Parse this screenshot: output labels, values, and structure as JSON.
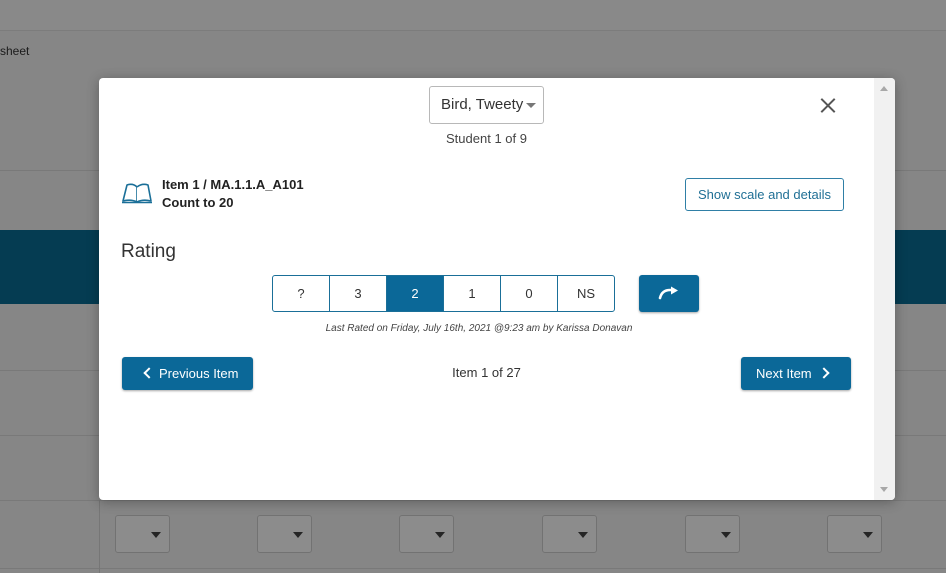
{
  "background": {
    "sheet_label": "sheet"
  },
  "modal": {
    "student_select": {
      "value": "Bird, Tweety"
    },
    "student_counter": "Student 1 of 9",
    "item": {
      "code": "Item 1 / MA.1.1.A_A101",
      "description": "Count to 20",
      "icon": "open-book-icon"
    },
    "show_scale_label": "Show scale and details",
    "rating": {
      "title": "Rating",
      "options": [
        "?",
        "3",
        "2",
        "1",
        "0",
        "NS"
      ],
      "selected": "2",
      "redo_icon": "redo-arrow-icon"
    },
    "last_rated": "Last Rated on Friday, July 16th, 2021 @9:23 am by Karissa Donavan",
    "navigation": {
      "previous_label": "Previous Item",
      "next_label": "Next Item",
      "item_counter": "Item 1 of 27"
    }
  },
  "colors": {
    "primary": "#0b6898",
    "band": "#0a6d96",
    "overlay": "rgba(0,0,0,0.45)"
  }
}
